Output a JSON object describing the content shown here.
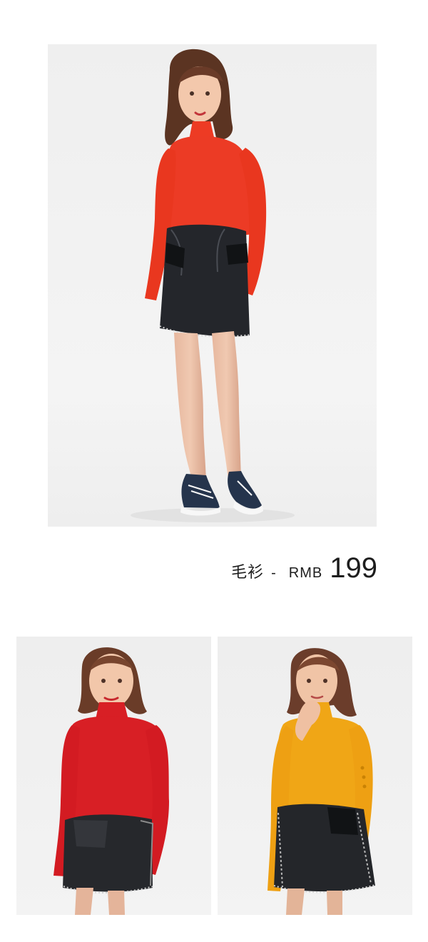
{
  "product_caption": {
    "name": "毛衫",
    "separator": "-",
    "currency": "RMB",
    "price": "199"
  },
  "images": {
    "hero": {
      "icon": "model-full-body-red-turtleneck-photo"
    },
    "bottom_left": {
      "icon": "model-red-turtleneck-photo"
    },
    "bottom_right": {
      "icon": "model-mustard-turtleneck-photo"
    }
  },
  "colors": {
    "red_sweater": "#ec3b25",
    "crimson_sweater": "#d81f25",
    "mustard_sweater": "#f0a616",
    "denim_skirt": "#25272b",
    "hair": "#5a3423",
    "background": "#f2f2f2"
  }
}
